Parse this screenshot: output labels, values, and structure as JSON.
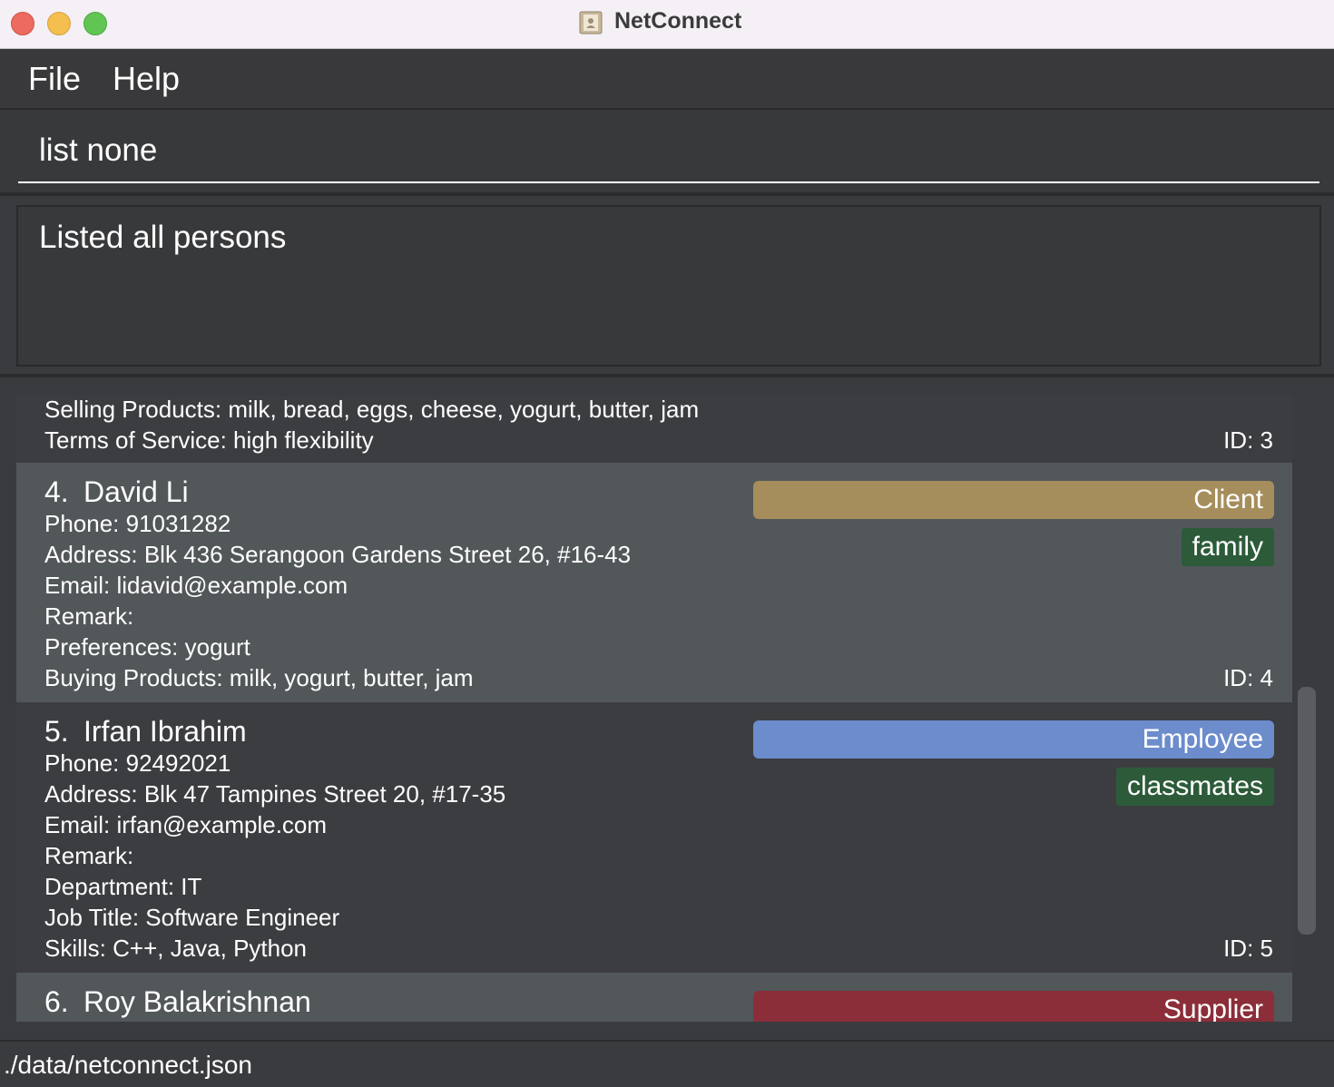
{
  "window": {
    "title": "NetConnect"
  },
  "menu": {
    "file": "File",
    "help": "Help"
  },
  "command": {
    "value": "list none"
  },
  "result": {
    "message": "Listed all persons"
  },
  "list": {
    "partial_card": {
      "lines": [
        "Selling Products: milk, bread, eggs, cheese, yogurt, butter, jam",
        "Terms of Service: high flexibility"
      ],
      "id": "ID: 3"
    },
    "cards": [
      {
        "index": "4.",
        "name": "David Li",
        "role": "Client",
        "role_color": "#a58e5c",
        "tags": [
          "family"
        ],
        "lines": [
          "Phone: 91031282",
          "Address: Blk 436 Serangoon Gardens Street 26, #16-43",
          "Email: lidavid@example.com",
          "Remark:",
          "Preferences: yogurt",
          "Buying Products: milk, yogurt, butter, jam"
        ],
        "id": "ID: 4"
      },
      {
        "index": "5.",
        "name": "Irfan Ibrahim",
        "role": "Employee",
        "role_color": "#6c8ccc",
        "tags": [
          "classmates"
        ],
        "lines": [
          "Phone: 92492021",
          "Address: Blk 47 Tampines Street 20, #17-35",
          "Email: irfan@example.com",
          "Remark:",
          "Department: IT",
          "Job Title: Software Engineer",
          "Skills: C++, Java, Python"
        ],
        "id": "ID: 5"
      },
      {
        "index": "6.",
        "name": "Roy Balakrishnan",
        "role": "Supplier",
        "role_color": "#8b2e39"
      }
    ]
  },
  "status": {
    "path": "./data/netconnect.json"
  }
}
